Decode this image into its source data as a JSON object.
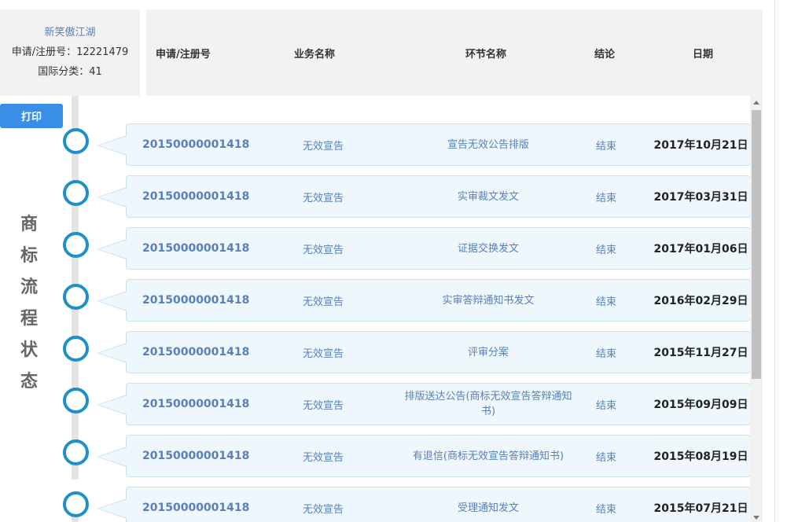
{
  "info": {
    "name": "新笑傲江湖",
    "reg_line": "申请/注册号：12221479",
    "class_line": "国际分类：41"
  },
  "header": {
    "reg_no": "申请/注册号",
    "business": "业务名称",
    "step": "环节名称",
    "result": "结论",
    "date": "日期"
  },
  "print_label": "打印",
  "vertical_title": [
    "商",
    "标",
    "流",
    "程",
    "状",
    "态"
  ],
  "rows": [
    {
      "reg_no": "20150000001418",
      "business": "无效宣告",
      "step": "宣告无效公告排版",
      "result": "结束",
      "date": "2017年10月21日"
    },
    {
      "reg_no": "20150000001418",
      "business": "无效宣告",
      "step": "实审裁文发文",
      "result": "结束",
      "date": "2017年03月31日"
    },
    {
      "reg_no": "20150000001418",
      "business": "无效宣告",
      "step": "证据交换发文",
      "result": "结束",
      "date": "2017年01月06日"
    },
    {
      "reg_no": "20150000001418",
      "business": "无效宣告",
      "step": "实审答辩通知书发文",
      "result": "结束",
      "date": "2016年02月29日"
    },
    {
      "reg_no": "20150000001418",
      "business": "无效宣告",
      "step": "评审分案",
      "result": "结束",
      "date": "2015年11月27日"
    },
    {
      "reg_no": "20150000001418",
      "business": "无效宣告",
      "step": "排版送达公告(商标无效宣告答辩通知书)",
      "result": "结束",
      "date": "2015年09月09日"
    },
    {
      "reg_no": "20150000001418",
      "business": "无效宣告",
      "step": "有退信(商标无效宣告答辩通知书)",
      "result": "结束",
      "date": "2015年08月19日"
    },
    {
      "reg_no": "20150000001418",
      "business": "无效宣告",
      "step": "受理通知发文",
      "result": "结束",
      "date": "2015年07月21日"
    }
  ]
}
